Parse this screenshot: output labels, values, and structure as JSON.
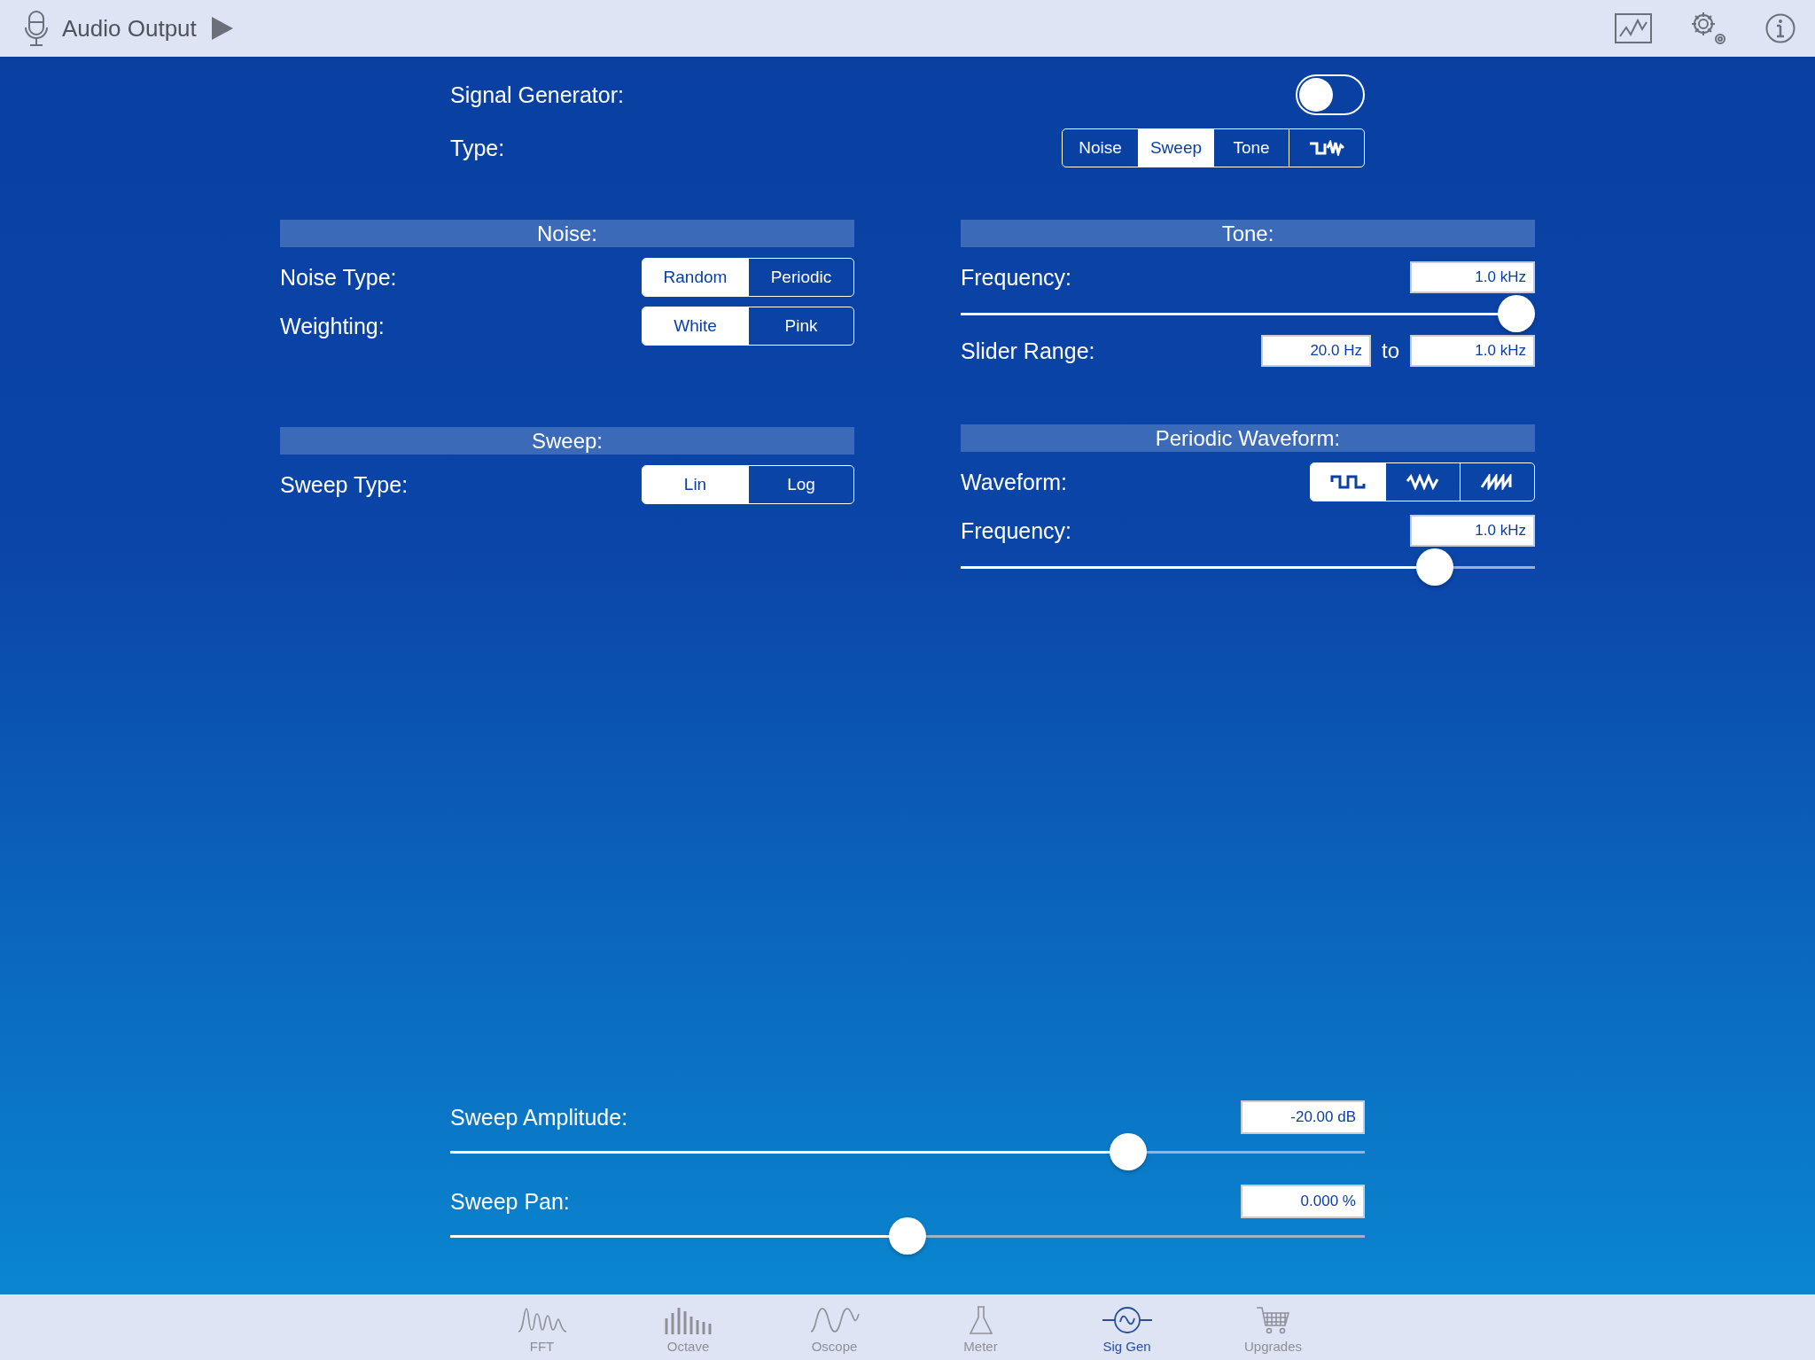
{
  "top_bar": {
    "title": "Audio Output"
  },
  "signal_generator": {
    "label": "Signal Generator:",
    "on": false
  },
  "type": {
    "label": "Type:",
    "options": [
      {
        "kind": "text",
        "label": "Noise",
        "selected": false
      },
      {
        "kind": "text",
        "label": "Sweep",
        "selected": true
      },
      {
        "kind": "text",
        "label": "Tone",
        "selected": false
      },
      {
        "kind": "square-noise",
        "selected": false
      }
    ]
  },
  "noise": {
    "title": "Noise:",
    "rows": [
      {
        "label": "Noise Type:",
        "options": [
          {
            "kind": "text",
            "label": "Random",
            "selected": true
          },
          {
            "kind": "text",
            "label": "Periodic",
            "selected": false
          }
        ]
      },
      {
        "label": "Weighting:",
        "options": [
          {
            "kind": "text",
            "label": "White",
            "selected": true
          },
          {
            "kind": "text",
            "label": "Pink",
            "selected": false
          }
        ]
      }
    ]
  },
  "tone": {
    "title": "Tone:",
    "frequency": {
      "label": "Frequency:",
      "value": "1.0 kHz",
      "level": 0.968
    },
    "slider_range": {
      "label": "Slider Range:",
      "from": "20.0 Hz",
      "separator": "to",
      "to": "1.0 kHz"
    }
  },
  "sweep": {
    "title": "Sweep:",
    "rows": [
      {
        "label": "Sweep Type:",
        "options": [
          {
            "kind": "text",
            "label": "Lin",
            "selected": true
          },
          {
            "kind": "text",
            "label": "Log",
            "selected": false
          }
        ]
      }
    ]
  },
  "periodic_waveform": {
    "title": "Periodic Waveform:",
    "waveform": {
      "label": "Waveform:",
      "options": [
        {
          "kind": "square",
          "selected": true
        },
        {
          "kind": "triangle",
          "selected": false
        },
        {
          "kind": "sawtooth",
          "selected": false
        }
      ]
    },
    "frequency": {
      "label": "Frequency:",
      "value": "1.0 kHz",
      "level": 0.826
    }
  },
  "sweep_amplitude": {
    "label": "Sweep Amplitude:",
    "value": "-20.00 dB",
    "level": 0.741
  },
  "sweep_pan": {
    "label": "Sweep Pan:",
    "value": "0.000 %",
    "level": 0.5
  },
  "tab_bar": [
    {
      "kind": "fft",
      "label": "FFT",
      "selected": false
    },
    {
      "kind": "octave",
      "label": "Octave",
      "selected": false
    },
    {
      "kind": "oscope",
      "label": "Oscope",
      "selected": false
    },
    {
      "kind": "meter",
      "label": "Meter",
      "selected": false
    },
    {
      "kind": "siggen",
      "label": "Sig Gen",
      "selected": true
    },
    {
      "kind": "cart",
      "label": "Upgrades",
      "selected": false
    }
  ]
}
